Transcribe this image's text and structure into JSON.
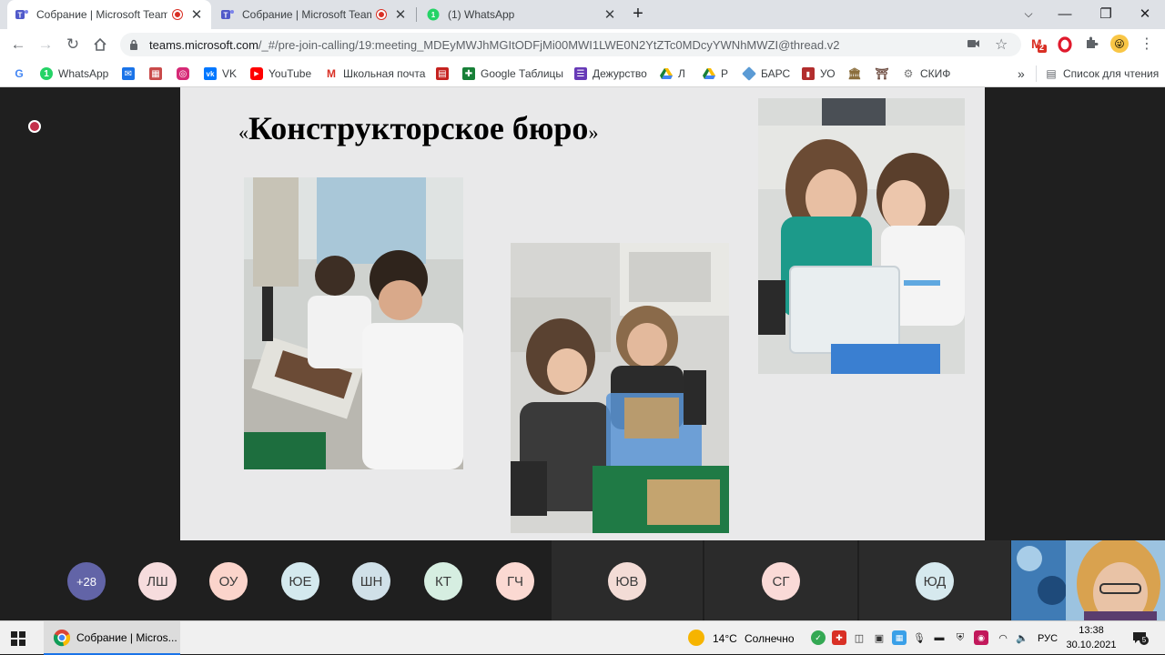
{
  "tabs": [
    {
      "title": "Собрание | Microsoft Teams",
      "recording": true,
      "active": true
    },
    {
      "title": "Собрание | Microsoft Teams",
      "recording": true,
      "active": false
    },
    {
      "title": "(1) WhatsApp",
      "recording": false,
      "active": false
    }
  ],
  "toolbar": {
    "url_host": "teams.microsoft.com",
    "url_path": "/_#/pre-join-calling/19:meeting_MDEyMWJhMGItODFjMi00MWI1LWE0N2YtZTc0MDcyYWNhMWZI@thread.v2",
    "mail_badge": "2"
  },
  "bookmarks": [
    {
      "label": "",
      "icon": "google-icon"
    },
    {
      "label": "WhatsApp",
      "icon": "whatsapp-icon"
    },
    {
      "label": "",
      "icon": "mail-icon"
    },
    {
      "label": "",
      "icon": "app-icon"
    },
    {
      "label": "",
      "icon": "instagram-icon"
    },
    {
      "label": "VK",
      "icon": "vk-icon"
    },
    {
      "label": "YouTube",
      "icon": "youtube-icon"
    },
    {
      "label": "Школьная почта",
      "icon": "gmail-icon"
    },
    {
      "label": "",
      "icon": "red-app-icon"
    },
    {
      "label": "Google Таблицы",
      "icon": "sheets-icon"
    },
    {
      "label": "Дежурство",
      "icon": "forms-icon"
    },
    {
      "label": "Л",
      "icon": "drive-icon"
    },
    {
      "label": "Р",
      "icon": "drive-icon"
    },
    {
      "label": "БАРС",
      "icon": "bars-icon"
    },
    {
      "label": "УО",
      "icon": "uo-icon"
    },
    {
      "label": "",
      "icon": "building-icon"
    },
    {
      "label": "",
      "icon": "emblem-icon"
    },
    {
      "label": "СКИФ",
      "icon": "skif-icon"
    }
  ],
  "bookmarks_more": "»",
  "reading_list": "Список для чтения",
  "slide": {
    "quote_open": "«",
    "title": "Конструкторское бюро",
    "quote_close": "»"
  },
  "participants": {
    "overflow": "+28",
    "avatars": [
      {
        "initials": "ЛШ",
        "color": "#f6dcdd"
      },
      {
        "initials": "ОУ",
        "color": "#fbd4cb"
      },
      {
        "initials": "ЮЕ",
        "color": "#d4e9ee"
      },
      {
        "initials": "ШН",
        "color": "#d0e0e8"
      },
      {
        "initials": "КТ",
        "color": "#d6eee1"
      },
      {
        "initials": "ГЧ",
        "color": "#fbd9d2"
      }
    ],
    "tiles": [
      {
        "initials": "ЮВ",
        "color": "#f3dcd6"
      },
      {
        "initials": "СГ",
        "color": "#fadad7"
      },
      {
        "initials": "ЮД",
        "color": "#d6e9ee"
      }
    ]
  },
  "taskbar": {
    "app_title": "Собрание | Micros...",
    "temperature": "14°C",
    "weather": "Солнечно",
    "language": "РУС",
    "time": "13:38",
    "date": "30.10.2021",
    "notifications": "5"
  }
}
